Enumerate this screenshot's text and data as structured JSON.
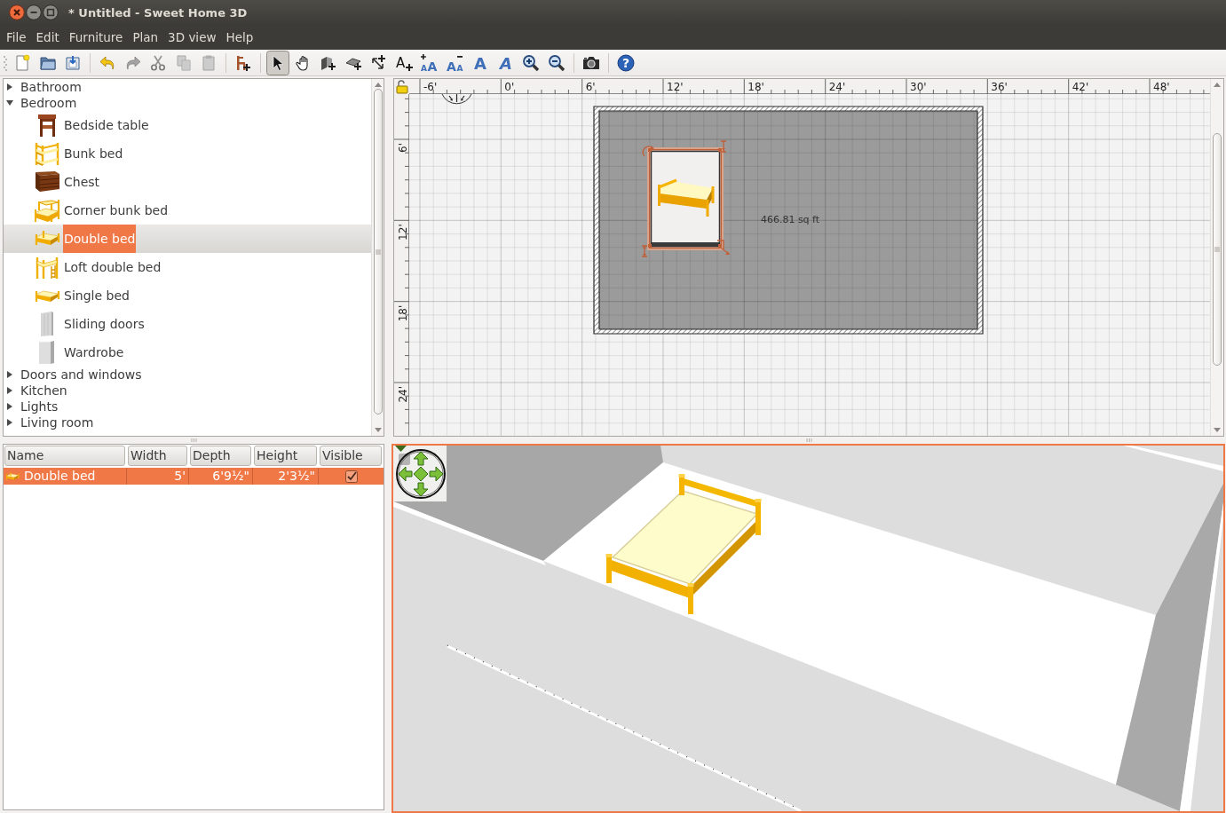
{
  "window": {
    "title": "* Untitled - Sweet Home 3D",
    "controls": [
      {
        "kind": "close"
      },
      {
        "kind": "minimize"
      },
      {
        "kind": "maximize"
      }
    ]
  },
  "menu": [
    {
      "label": "File"
    },
    {
      "label": "Edit"
    },
    {
      "label": "Furniture"
    },
    {
      "label": "Plan"
    },
    {
      "label": "3D view"
    },
    {
      "label": "Help"
    }
  ],
  "toolbar": [
    {
      "items": [
        {
          "kind": "new",
          "disabled": false
        },
        {
          "kind": "open",
          "disabled": false
        },
        {
          "kind": "save",
          "disabled": false
        }
      ]
    },
    {
      "items": [
        {
          "kind": "undo",
          "disabled": false
        },
        {
          "kind": "redo",
          "disabled": true
        },
        {
          "kind": "cut",
          "disabled": true
        },
        {
          "kind": "copy",
          "disabled": true
        },
        {
          "kind": "paste",
          "disabled": true
        }
      ]
    },
    {
      "items": [
        {
          "kind": "add-furniture",
          "disabled": false
        }
      ]
    },
    {
      "items": [
        {
          "kind": "select",
          "disabled": false,
          "selected": true
        },
        {
          "kind": "pan",
          "disabled": false,
          "selected": false
        },
        {
          "kind": "create-walls",
          "disabled": false,
          "selected": false
        },
        {
          "kind": "create-rooms",
          "disabled": false,
          "selected": false
        },
        {
          "kind": "create-dimensions",
          "disabled": false,
          "selected": false
        },
        {
          "kind": "add-text",
          "disabled": false,
          "selected": false,
          "glyphs": [
            "A"
          ]
        },
        {
          "kind": "increase-text",
          "disabled": false,
          "selected": false,
          "glyphs": [
            "A",
            "A"
          ]
        },
        {
          "kind": "decrease-text",
          "disabled": false,
          "selected": false,
          "glyphs": [
            "A",
            "A"
          ]
        },
        {
          "kind": "bold",
          "disabled": false,
          "selected": false,
          "glyphs": [
            "A"
          ]
        },
        {
          "kind": "italic",
          "disabled": false,
          "selected": false,
          "glyphs": [
            "A"
          ]
        },
        {
          "kind": "zoom-in",
          "disabled": false,
          "selected": false
        },
        {
          "kind": "zoom-out",
          "disabled": false,
          "selected": false
        }
      ]
    },
    {
      "items": [
        {
          "kind": "photo",
          "disabled": false
        }
      ]
    },
    {
      "items": [
        {
          "kind": "help",
          "disabled": false,
          "glyphs": [
            "?"
          ]
        }
      ]
    }
  ],
  "catalog": {
    "categories": [
      {
        "label": "Bathroom",
        "expanded": false,
        "selected": false
      },
      {
        "label": "Bedroom",
        "expanded": true,
        "selected": false,
        "children": [
          {
            "label": "Bedside table",
            "kind": "bedside-table",
            "selected": false
          },
          {
            "label": "Bunk bed",
            "kind": "bunk-bed",
            "selected": false
          },
          {
            "label": "Chest",
            "kind": "chest",
            "selected": false
          },
          {
            "label": "Corner bunk bed",
            "kind": "corner-bunk-bed",
            "selected": false
          },
          {
            "label": "Double bed",
            "kind": "double-bed",
            "selected": true
          },
          {
            "label": "Loft double bed",
            "kind": "loft-double-bed",
            "selected": false
          },
          {
            "label": "Single bed",
            "kind": "single-bed",
            "selected": false
          },
          {
            "label": "Sliding doors",
            "kind": "sliding-doors",
            "selected": false
          },
          {
            "label": "Wardrobe",
            "kind": "wardrobe",
            "selected": false
          }
        ]
      },
      {
        "label": "Doors and windows",
        "expanded": false,
        "selected": false
      },
      {
        "label": "Kitchen",
        "expanded": false,
        "selected": false
      },
      {
        "label": "Lights",
        "expanded": false,
        "selected": false
      },
      {
        "label": "Living room",
        "expanded": false,
        "selected": false
      }
    ]
  },
  "furniture_table": {
    "columns": [
      "Name",
      "Width",
      "Depth",
      "Height",
      "Visible"
    ],
    "rows": [
      {
        "kind": "double-bed",
        "name": "Double bed",
        "width": "5'",
        "depth": "6'9½\"",
        "height": "2'3½\"",
        "visible": true,
        "selected": true
      }
    ]
  },
  "plan": {
    "ruler_x": [
      "-6'",
      "0'",
      "6'",
      "12'",
      "18'",
      "24'",
      "30'",
      "36'",
      "42'",
      "48'"
    ],
    "ruler_y": [
      "6'",
      "12'",
      "18'",
      "24'"
    ],
    "rooms": [
      {
        "area": "466.81 sq ft"
      }
    ],
    "furniture": [
      {
        "kind": "double-bed",
        "selected": true
      }
    ]
  },
  "view_3d": {
    "focused": true,
    "furniture": [
      {
        "kind": "double-bed"
      }
    ]
  }
}
